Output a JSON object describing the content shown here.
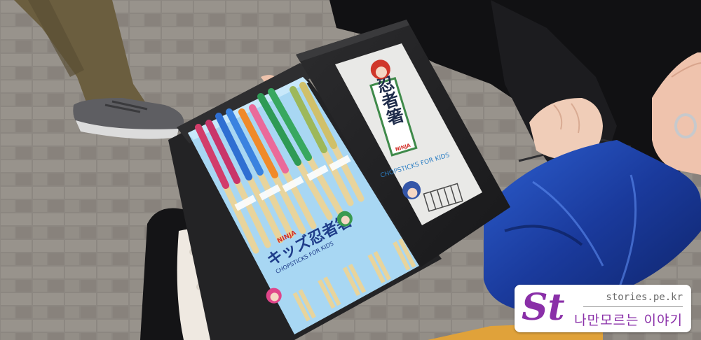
{
  "photo": {
    "box_label_top": "NINJA",
    "box_title": "キッズ忍者箸",
    "box_subtitle": "CHOPSTICKS FOR KIDS",
    "lid_title": "忍者箸",
    "lid_badge": "NINJA",
    "lid_subtitle": "CHOPSTICKS FOR KIDS"
  },
  "watermark": {
    "logo": "St",
    "url": "stories.pe.kr",
    "slogan": "나만모르는 이야기",
    "accent_color": "#8a2fa8"
  }
}
